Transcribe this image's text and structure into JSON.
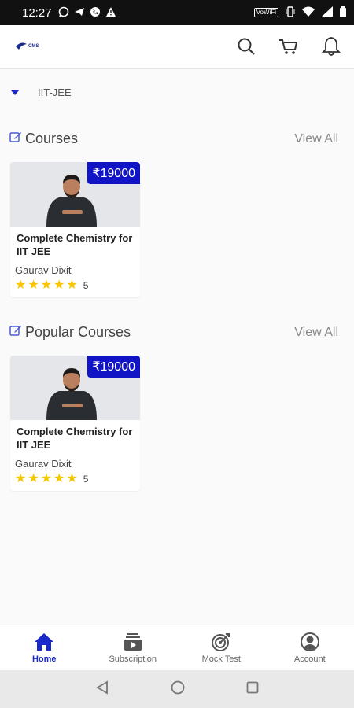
{
  "status_bar": {
    "time": "12:27",
    "vowifi": "VoWiFi"
  },
  "header": {
    "logo_text": "CMS",
    "icons": [
      "search-icon",
      "cart-icon",
      "bell-icon"
    ]
  },
  "category": {
    "selected": "IIT-JEE"
  },
  "sections": [
    {
      "title": "Courses",
      "view_all": "View All",
      "courses": [
        {
          "price": "₹19000",
          "title": "Complete Chemistry for IIT JEE",
          "instructor": "Gaurav Dixit",
          "rating_stars": 5,
          "rating_count": "5"
        }
      ]
    },
    {
      "title": "Popular Courses",
      "view_all": "View All",
      "courses": [
        {
          "price": "₹19000",
          "title": "Complete Chemistry for IIT JEE",
          "instructor": "Gaurav Dixit",
          "rating_stars": 5,
          "rating_count": "5"
        }
      ]
    }
  ],
  "bottom_nav": {
    "items": [
      {
        "label": "Home",
        "icon": "home-icon",
        "active": true
      },
      {
        "label": "Subscription",
        "icon": "subscription-icon",
        "active": false
      },
      {
        "label": "Mock Test",
        "icon": "target-icon",
        "active": false
      },
      {
        "label": "Account",
        "icon": "account-icon",
        "active": false
      }
    ]
  },
  "colors": {
    "accent": "#1a2ac8",
    "price_badge": "#1014c4",
    "star": "#f7c600"
  }
}
